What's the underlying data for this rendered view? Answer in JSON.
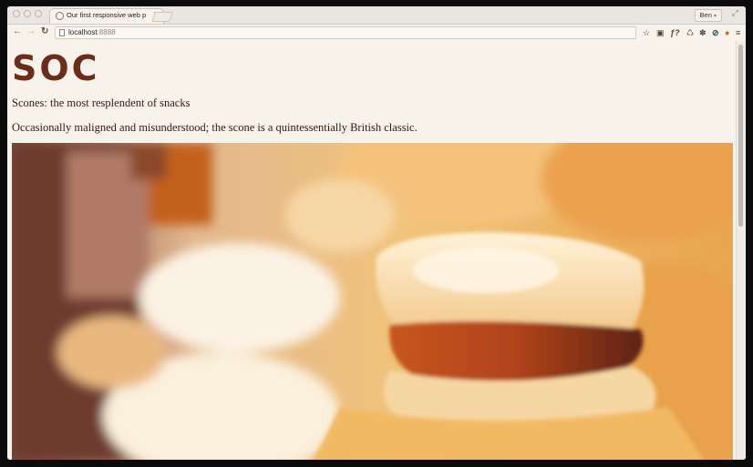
{
  "browser": {
    "tab_title": "Our first responsive web p",
    "tab_close": "×",
    "user_name": "Ben",
    "url_host": "localhost",
    "url_port": ":8888"
  },
  "page": {
    "logo": "SOC",
    "heading": "Scones: the most resplendent of snacks",
    "intro": "Occasionally maligned and misunderstood; the scone is a quintessentially British classic."
  },
  "colors": {
    "logo": "#6b2c1c",
    "page_background": "#f7f2ea"
  },
  "icons": {
    "back": "back-arrow-icon",
    "forward": "forward-arrow-icon",
    "reload": "reload-icon",
    "star": "bookmark-star-icon",
    "menu": "menu-icon"
  }
}
